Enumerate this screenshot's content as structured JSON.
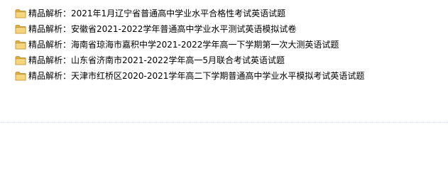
{
  "files": [
    {
      "icon": "folder-icon",
      "name": "精品解析：2021年1月辽宁省普通高中学业水平合格性考试英语试题"
    },
    {
      "icon": "folder-icon",
      "name": "精品解析：安徽省2021-2022学年普通高中学业水平测试英语模拟试卷"
    },
    {
      "icon": "folder-icon",
      "name": "精品解析：海南省琼海市嘉积中学2021-2022学年高一下学期第一次大测英语试题"
    },
    {
      "icon": "folder-icon",
      "name": "精品解析：山东省济南市2021-2022学年高一5月联合考试英语试题"
    },
    {
      "icon": "folder-icon",
      "name": "精品解析：天津市红桥区2020-2021学年高二下学期普通高中学业水平模拟考试英语试题"
    }
  ],
  "colors": {
    "folder_body": "#e8b84a",
    "folder_front": "#f4d27a",
    "folder_edge": "#b8862a",
    "background": "#ffffff"
  }
}
